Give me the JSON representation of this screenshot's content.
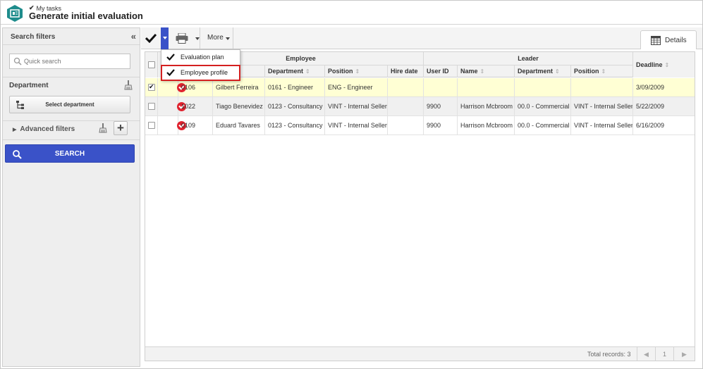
{
  "header": {
    "breadcrumb": "My tasks",
    "title": "Generate initial evaluation"
  },
  "sidebar": {
    "title": "Search filters",
    "collapse_glyph": "«",
    "quick_search_placeholder": "Quick search",
    "department_label": "Department",
    "select_department_label": "Select department",
    "advanced_filters_label": "Advanced filters",
    "search_label": "SEARCH"
  },
  "toolbar": {
    "more_label": "More",
    "details_label": "Details"
  },
  "dropdown": {
    "items": [
      {
        "label": "Evaluation plan"
      },
      {
        "label": "Employee profile"
      }
    ]
  },
  "grid": {
    "groups": {
      "employee": "Employee",
      "leader": "Leader"
    },
    "columns": {
      "emp_department": "Department",
      "emp_position": "Position",
      "hire_date": "Hire date",
      "user_id": "User ID",
      "leader_name": "Name",
      "leader_department": "Department",
      "leader_position": "Position",
      "deadline": "Deadline"
    },
    "sort_glyph": "⇕",
    "rows": [
      {
        "id": "0106",
        "name": "Gilbert Ferreira",
        "department": "0161 - Engineer",
        "position": "ENG - Engineer",
        "hire_date": "",
        "user_id": "",
        "leader_name": "",
        "leader_department": "",
        "leader_position": "",
        "deadline": "3/09/2009"
      },
      {
        "id": "1022",
        "name": "Tiago Benevidez",
        "department": "0123 - Consultancy",
        "position": "VINT - Internal Seller",
        "hire_date": "",
        "user_id": "9900",
        "leader_name": "Harrison Mcbroom",
        "leader_department": "00.0 - Commercial",
        "leader_position": "VINT - Internal Seller",
        "deadline": "5/22/2009"
      },
      {
        "id": "0109",
        "name": "Eduard Tavares",
        "department": "0123 - Consultancy",
        "position": "VINT - Internal Seller",
        "hire_date": "",
        "user_id": "9900",
        "leader_name": "Harrison Mcbroom",
        "leader_department": "00.0 - Commercial",
        "leader_position": "VINT - Internal Seller",
        "deadline": "6/16/2009"
      }
    ],
    "footer": {
      "total_records": "Total records: 3",
      "page": "1",
      "prev_glyph": "◀",
      "next_glyph": "▶"
    }
  },
  "colors": {
    "accent": "#3a52c8",
    "status_red": "#e0222e",
    "selected_row": "#ffffd4",
    "highlight_outline": "#d42020",
    "logo_teal": "#1e8c8c"
  }
}
